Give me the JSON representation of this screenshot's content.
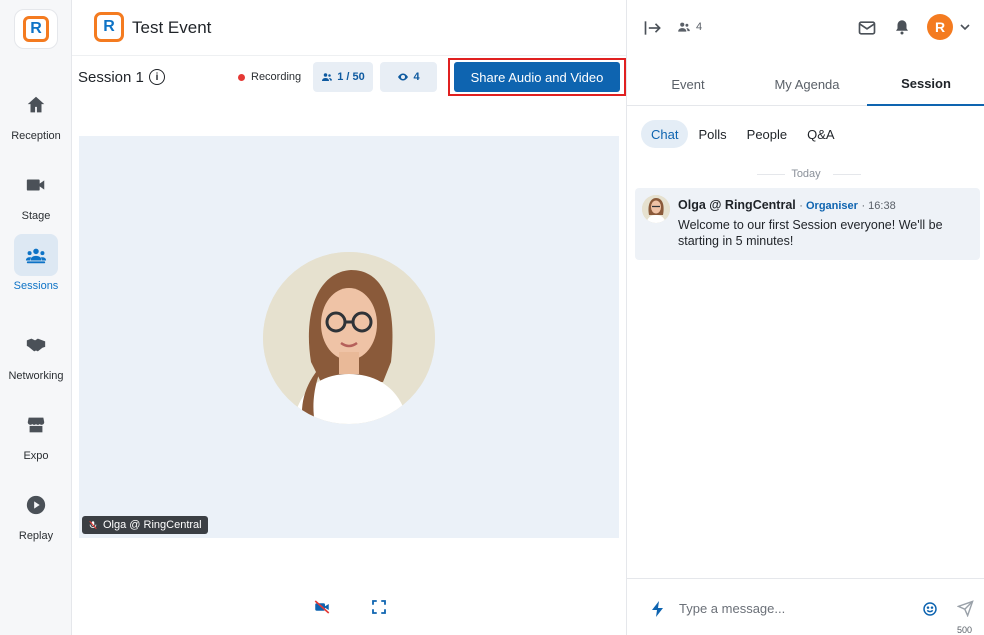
{
  "app": {
    "logo_letter": "R",
    "event_title": "Test Event",
    "brand_colors": {
      "primary": "#0e64b0",
      "accent": "#f47b20",
      "recording": "#e53935"
    }
  },
  "nav": {
    "items": [
      {
        "label": "Reception",
        "icon": "home-icon",
        "active": false
      },
      {
        "label": "Stage",
        "icon": "video-camera-icon",
        "active": false
      },
      {
        "label": "Sessions",
        "icon": "people-group-icon",
        "active": true
      },
      {
        "label": "Networking",
        "icon": "handshake-icon",
        "active": false
      },
      {
        "label": "Expo",
        "icon": "storefront-icon",
        "active": false
      },
      {
        "label": "Replay",
        "icon": "play-circle-icon",
        "active": false
      }
    ]
  },
  "session": {
    "title": "Session 1",
    "recording_label": "Recording",
    "attendees": "1 / 50",
    "viewers": "4",
    "share_button": "Share Audio and Video",
    "participant_name": "Olga @ RingCentral"
  },
  "panel": {
    "people_count": "4",
    "user_initial": "R",
    "tabs": [
      {
        "label": "Event",
        "active": false
      },
      {
        "label": "My Agenda",
        "active": false
      },
      {
        "label": "Session",
        "active": true
      }
    ],
    "subtabs": [
      {
        "label": "Chat",
        "active": true
      },
      {
        "label": "Polls",
        "active": false
      },
      {
        "label": "People",
        "active": false
      },
      {
        "label": "Q&A",
        "active": false
      }
    ],
    "day_divider": "Today",
    "message": {
      "author": "Olga @ RingCentral",
      "role": "Organiser",
      "time": "16:38",
      "text": "Welcome to our first Session everyone! We'll be starting in 5 minutes!"
    },
    "composer": {
      "placeholder": "Type a message...",
      "char_limit": "500"
    }
  }
}
